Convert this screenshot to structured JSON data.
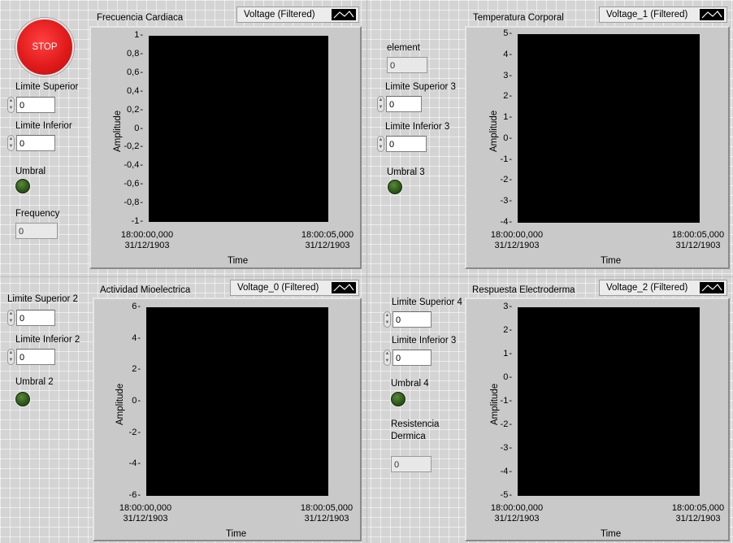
{
  "stop_button": {
    "label": "STOP"
  },
  "panel1": {
    "controls": {
      "limite_superior": {
        "label": "Limite Superior",
        "value": "0"
      },
      "limite_inferior": {
        "label": "Limite Inferior",
        "value": "0"
      },
      "umbral": {
        "label": "Umbral"
      },
      "frequency": {
        "label": "Frequency",
        "value": "0"
      }
    },
    "chart": {
      "title": "Frecuencia Cardiaca",
      "legend": "Voltage (Filtered)",
      "ylabel": "Amplitude",
      "xlabel": "Time",
      "yticks": [
        "1",
        "0,8",
        "0,6",
        "0,4",
        "0,2",
        "0",
        "-0,2",
        "-0,4",
        "-0,6",
        "-0,8",
        "-1"
      ],
      "x_start": {
        "time": "18:00:00,000",
        "date": "31/12/1903"
      },
      "x_end": {
        "time": "18:00:05,000",
        "date": "31/12/1903"
      }
    }
  },
  "panel2": {
    "controls": {
      "element": {
        "label": "element",
        "value": "0"
      },
      "limite_superior": {
        "label": "Limite Superior 3",
        "value": "0"
      },
      "limite_inferior": {
        "label": "Limite Inferior 3",
        "value": "0"
      },
      "umbral": {
        "label": "Umbral 3"
      }
    },
    "chart": {
      "title": "Temperatura Corporal",
      "legend": "Voltage_1 (Filtered)",
      "ylabel": "Amplitude",
      "xlabel": "Time",
      "yticks": [
        "5",
        "4",
        "3",
        "2",
        "1",
        "0",
        "-1",
        "-2",
        "-3",
        "-4"
      ],
      "x_start": {
        "time": "18:00:00,000",
        "date": "31/12/1903"
      },
      "x_end": {
        "time": "18:00:05,000",
        "date": "31/12/1903"
      }
    }
  },
  "panel3": {
    "controls": {
      "limite_superior": {
        "label": "Limite Superior 2",
        "value": "0"
      },
      "limite_inferior": {
        "label": "Limite Inferior 2",
        "value": "0"
      },
      "umbral": {
        "label": "Umbral 2"
      }
    },
    "chart": {
      "title": "Actividad Mioelectrica",
      "legend": "Voltage_0 (Filtered)",
      "ylabel": "Amplitude",
      "xlabel": "Time",
      "yticks": [
        "6",
        "4",
        "2",
        "0",
        "-2",
        "-4",
        "-6"
      ],
      "x_start": {
        "time": "18:00:00,000",
        "date": "31/12/1903"
      },
      "x_end": {
        "time": "18:00:05,000",
        "date": "31/12/1903"
      }
    }
  },
  "panel4": {
    "controls": {
      "limite_superior": {
        "label": "Limite Superior 4",
        "value": "0"
      },
      "limite_inferior": {
        "label": "Limite Inferior 3",
        "value": "0"
      },
      "umbral": {
        "label": "Umbral 4"
      },
      "resistencia": {
        "label_line1": "Resistencia",
        "label_line2": "Dermica",
        "value": "0"
      }
    },
    "chart": {
      "title": "Respuesta Electroderma",
      "legend": "Voltage_2 (Filtered)",
      "ylabel": "Amplitude",
      "xlabel": "Time",
      "yticks": [
        "3",
        "2",
        "1",
        "0",
        "-1",
        "-2",
        "-3",
        "-4",
        "-5"
      ],
      "x_start": {
        "time": "18:00:00,000",
        "date": "31/12/1903"
      },
      "x_end": {
        "time": "18:00:05,000",
        "date": "31/12/1903"
      }
    }
  },
  "colors": {
    "stop_red": "#e11b1b",
    "led_off": "#2f5a1c",
    "plot_background": "#000000",
    "panel_background": "#d4d4d4"
  }
}
